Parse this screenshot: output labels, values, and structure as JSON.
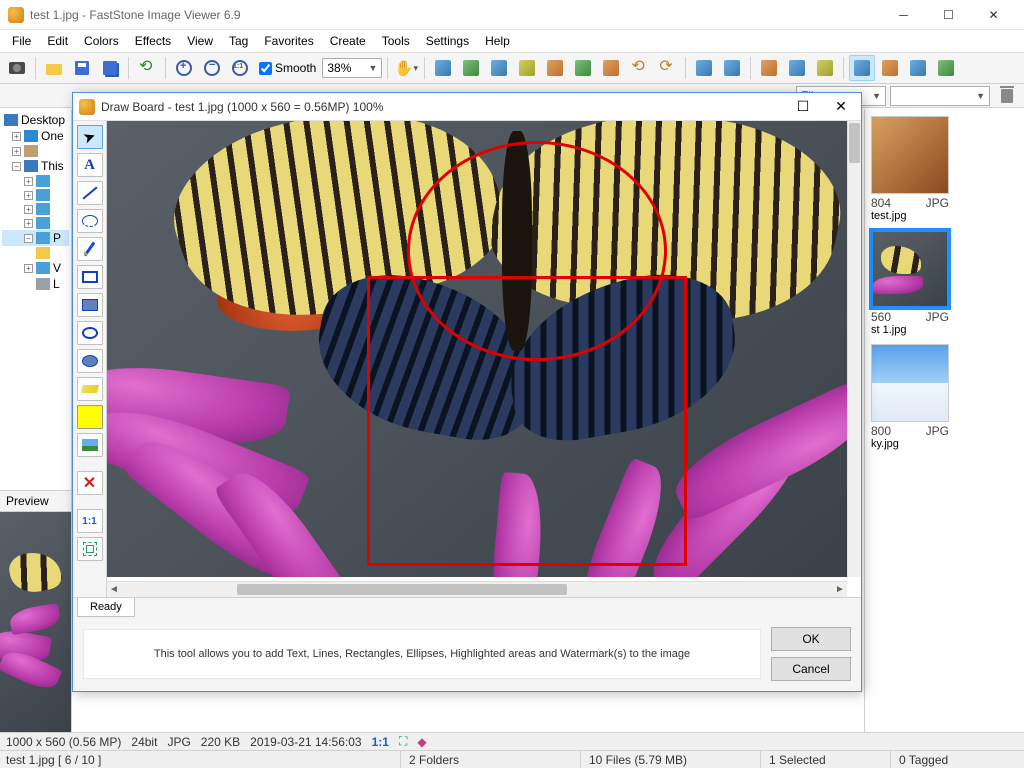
{
  "window": {
    "title": "test 1.jpg  -  FastStone Image Viewer 6.9"
  },
  "menu": [
    "File",
    "Edit",
    "Colors",
    "Effects",
    "View",
    "Tag",
    "Favorites",
    "Create",
    "Tools",
    "Settings",
    "Help"
  ],
  "toolbar": {
    "smooth_label": "Smooth",
    "zoom": "38%"
  },
  "secbar": {
    "sort": "Filename"
  },
  "tree": {
    "root": "Desktop",
    "items": [
      "One",
      "",
      "This",
      "",
      "",
      "",
      "",
      "",
      "P",
      "",
      "V",
      "L"
    ]
  },
  "tree_onedrive": "One",
  "tree_thispc": "This",
  "preview_label": "Preview",
  "thumbs": [
    {
      "dim": "804",
      "ext": "JPG",
      "name": "test.jpg"
    },
    {
      "dim": "560",
      "ext": "JPG",
      "name": "st 1.jpg"
    },
    {
      "dim": "800",
      "ext": "JPG",
      "name": "ky.jpg"
    }
  ],
  "status1": {
    "dims": "1000 x 560 (0.56 MP)",
    "depth": "24bit",
    "fmt": "JPG",
    "size": "220 KB",
    "date": "2019-03-21 14:56:03",
    "ratio": "1:1"
  },
  "status2": {
    "file": "test 1.jpg [ 6 / 10 ]",
    "folders": "2 Folders",
    "files": "10 Files (5.79 MB)",
    "selected": "1 Selected",
    "tagged": "0 Tagged"
  },
  "dialog": {
    "title": "Draw Board  -  test 1.jpg   (1000 x 560 = 0.56MP)     100%",
    "tab": "Ready",
    "msg": "This tool allows you to add Text, Lines, Rectangles, Ellipses, Highlighted areas and Watermark(s) to the image",
    "ok": "OK",
    "cancel": "Cancel"
  }
}
